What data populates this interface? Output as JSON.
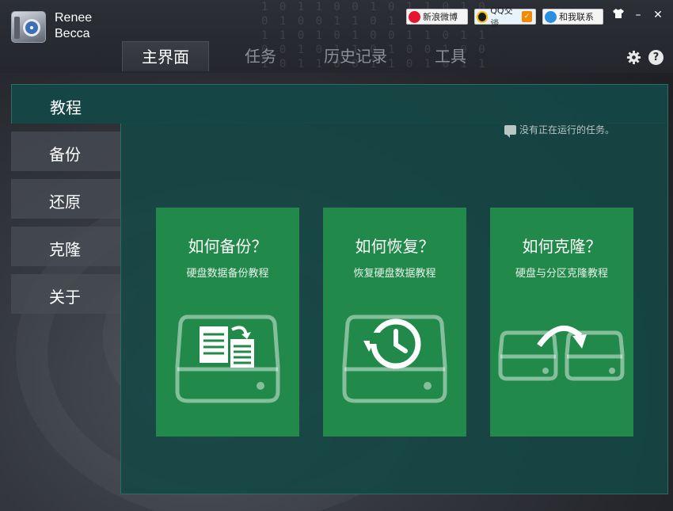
{
  "app": {
    "name_line1": "Renee",
    "name_line2": "Becca"
  },
  "share": {
    "weibo_label": "新浪微博",
    "qq_label": "QQ交谈",
    "contact_label": "和我联系"
  },
  "window_controls": {
    "skin_icon": "shirt-icon",
    "minimize": "–",
    "close": "✕"
  },
  "tabs": [
    {
      "label": "主界面",
      "active": true
    },
    {
      "label": "任务",
      "active": false
    },
    {
      "label": "历史记录",
      "active": false
    },
    {
      "label": "工具",
      "active": false
    }
  ],
  "toolbar_icons": {
    "settings": "gear-icon",
    "help": "?"
  },
  "sidebar": {
    "items": [
      {
        "label": "教程",
        "active": true
      },
      {
        "label": "备份",
        "active": false
      },
      {
        "label": "还原",
        "active": false
      },
      {
        "label": "克隆",
        "active": false
      },
      {
        "label": "关于",
        "active": false
      }
    ]
  },
  "status_text": "没有正在运行的任务。",
  "cards": [
    {
      "title": "如何备份？",
      "subtitle": "硬盘数据备份教程",
      "icon": "backup-disk-icon"
    },
    {
      "title": "如何恢复？",
      "subtitle": "恢复硬盘数据教程",
      "icon": "restore-disk-icon"
    },
    {
      "title": "如何克隆？",
      "subtitle": "硬盘与分区克隆教程",
      "icon": "clone-disk-icon"
    }
  ],
  "colors": {
    "card_green": "#21894a",
    "panel_teal": "#154846",
    "window_dark": "#24262b"
  }
}
